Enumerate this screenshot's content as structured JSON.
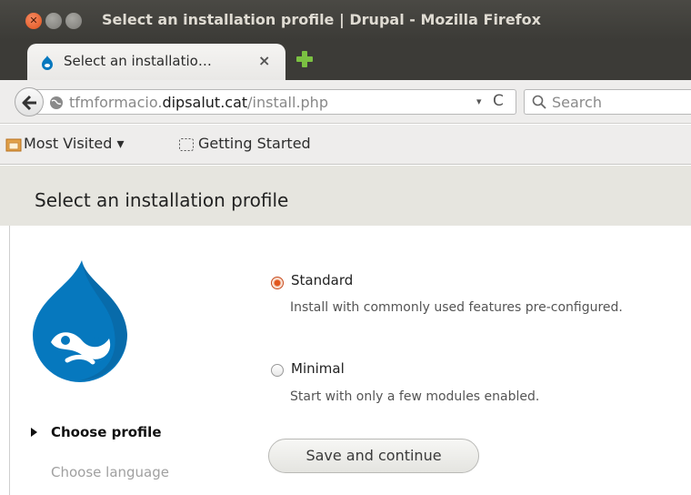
{
  "window": {
    "title": "Select an installation profile | Drupal - Mozilla Firefox",
    "close_glyph": "✕",
    "icons": [
      "close-window-icon",
      "minimize-window-icon",
      "maximize-window-icon"
    ]
  },
  "tabs": [
    {
      "title": "Select an installatio…",
      "close_glyph": "×",
      "favicon": "drupal-favicon-icon"
    }
  ],
  "newtab_icon": "plus-icon",
  "navbar": {
    "url_prefix": "tfmformacio.",
    "url_domain": "dipsalut.cat",
    "url_path": "/install.php",
    "dropdown_glyph": "▾",
    "reload_glyph": "C",
    "search_placeholder": "Search"
  },
  "bookmarks": [
    {
      "label": "Most Visited ▾",
      "icon": "folder-icon"
    },
    {
      "label": "Getting Started",
      "icon": "page-icon"
    }
  ],
  "page": {
    "title": "Select an installation profile",
    "steps": {
      "active": "Choose profile",
      "next": "Choose language"
    },
    "options": [
      {
        "label": "Standard",
        "description": "Install with commonly used features pre-configured.",
        "checked": true
      },
      {
        "label": "Minimal",
        "description": "Start with only a few modules enabled.",
        "checked": false
      }
    ],
    "submit_label": "Save and continue"
  },
  "colors": {
    "accent": "#e2571e",
    "drupal_blue": "#0678be",
    "header_bg": "#e6e5df",
    "titlebar_bg": "#3c3b37"
  }
}
